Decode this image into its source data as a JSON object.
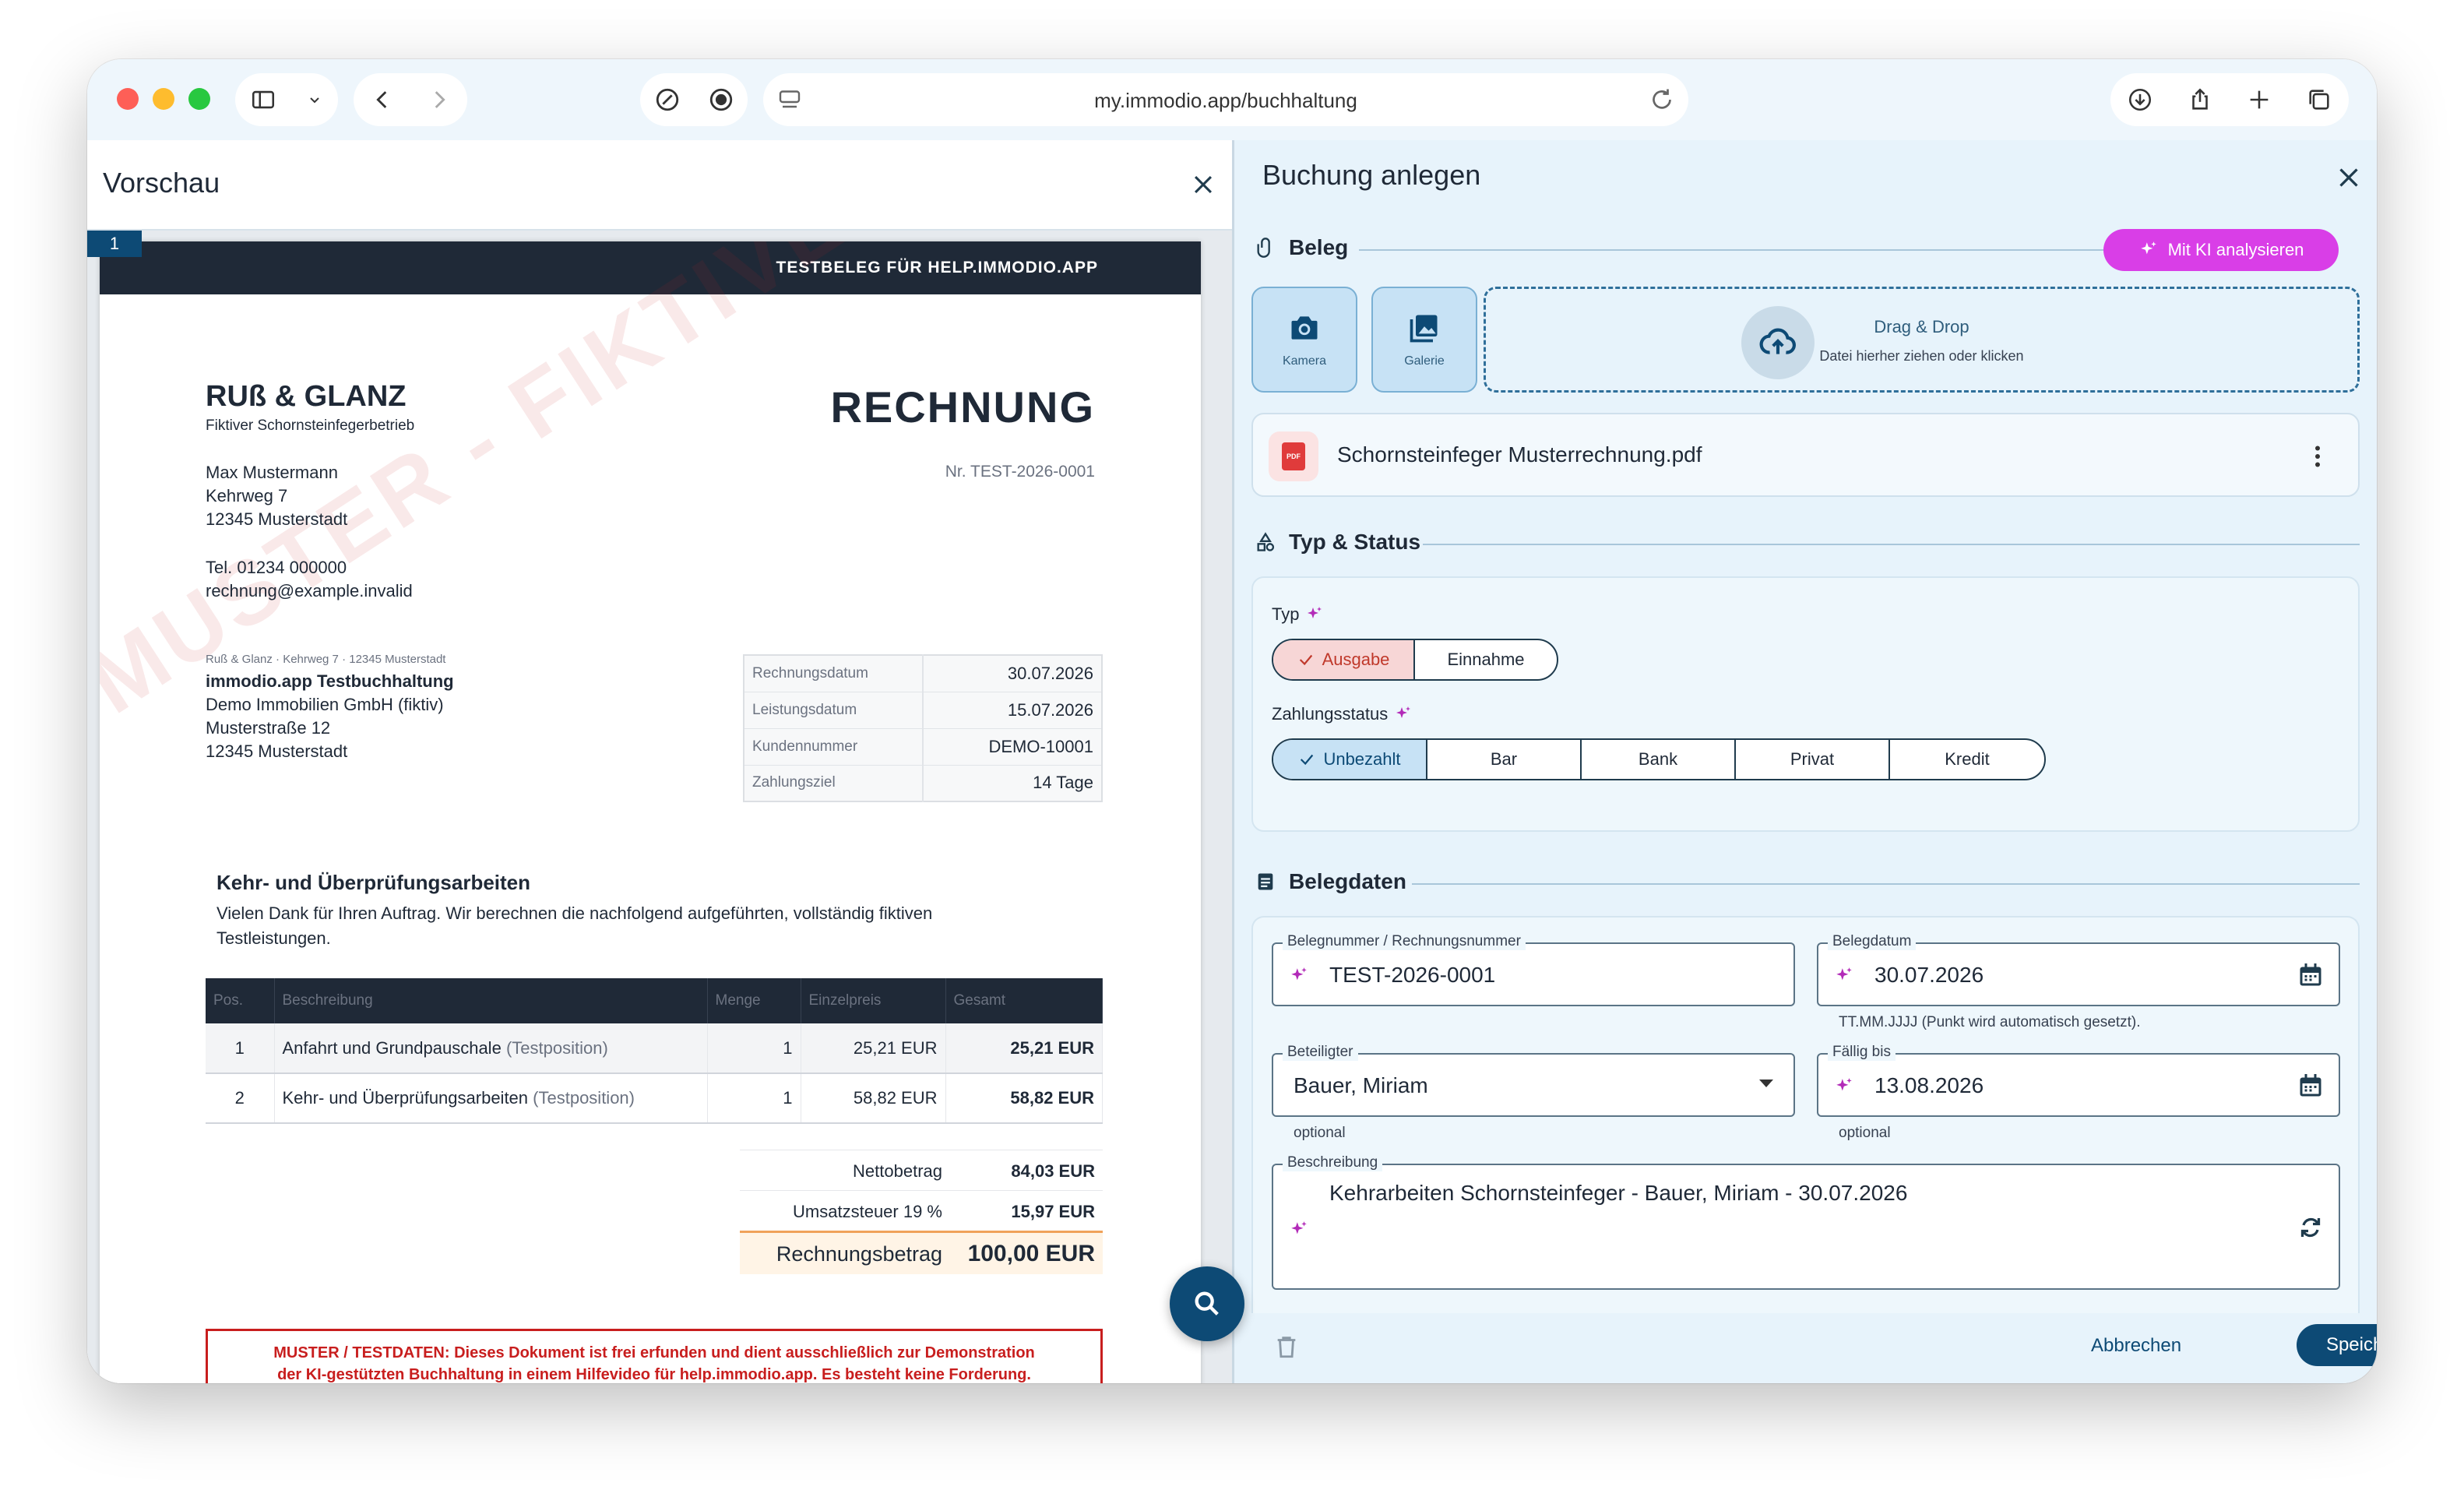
{
  "browser": {
    "url": "my.immodio.app/buchhaltung"
  },
  "preview": {
    "title": "Vorschau",
    "page_number": "1",
    "document": {
      "header_banner": "TESTBELEG FÜR HELP.IMMODIO.APP",
      "watermark": "MUSTER - FIKTIVE TESTDATEN - NUR TESTDATEN",
      "company_name": "RUß & GLANZ",
      "company_tagline": "Fiktiver Schornsteinfegerbetrieb",
      "sender_name": "Max Mustermann",
      "sender_street": "Kehrweg 7",
      "sender_city": "12345 Musterstadt",
      "sender_phone": "Tel. 01234 000000",
      "sender_email": "rechnung@example.invalid",
      "doc_title": "RECHNUNG",
      "doc_number": "Nr. TEST-2026-0001",
      "return_address": "Ruß & Glanz · Kehrweg 7 · 12345 Musterstadt",
      "recipient_line1": "immodio.app Testbuchhaltung",
      "recipient_line2": "Demo Immobilien GmbH (fiktiv)",
      "recipient_line3": "Musterstraße 12",
      "recipient_line4": "12345 Musterstadt",
      "meta": [
        {
          "key": "Rechnungsdatum",
          "value": "30.07.2026"
        },
        {
          "key": "Leistungsdatum",
          "value": "15.07.2026"
        },
        {
          "key": "Kundennummer",
          "value": "DEMO-10001"
        },
        {
          "key": "Zahlungsziel",
          "value": "14 Tage"
        }
      ],
      "section_title": "Kehr- und Überprüfungsarbeiten",
      "intro_line1": "Vielen Dank für Ihren Auftrag. Wir berechnen die nachfolgend aufgeführten, vollständig fiktiven",
      "intro_line2": "Testleistungen.",
      "table_headers": [
        "Pos.",
        "Beschreibung",
        "Menge",
        "Einzelpreis",
        "Gesamt"
      ],
      "rows": [
        {
          "pos": "1",
          "desc": "Anfahrt und Grundpauschale",
          "note": "(Testposition)",
          "qty": "1",
          "unit": "25,21 EUR",
          "total": "25,21 EUR"
        },
        {
          "pos": "2",
          "desc": "Kehr- und Überprüfungsarbeiten",
          "note": "(Testposition)",
          "qty": "1",
          "unit": "58,82 EUR",
          "total": "58,82 EUR"
        }
      ],
      "net_label": "Nettobetrag",
      "net_value": "84,03 EUR",
      "vat_label": "Umsatzsteuer 19 %",
      "vat_value": "15,97 EUR",
      "gross_label": "Rechnungsbetrag",
      "gross_value": "100,00 EUR",
      "warning_line1": "MUSTER / TESTDATEN: Dieses Dokument ist frei erfunden und dient ausschließlich zur Demonstration",
      "warning_line2": "der KI-gestützten Buchhaltung in einem Hilfevideo für help.immodio.app. Es besteht keine Forderung."
    }
  },
  "form": {
    "title": "Buchung anlegen",
    "beleg": {
      "heading": "Beleg",
      "ai_button": "Mit KI analysieren",
      "camera_label": "Kamera",
      "gallery_label": "Galerie",
      "drop_title": "Drag & Drop",
      "drop_subtitle": "Datei hierher ziehen oder klicken",
      "file_name": "Schornsteinfeger Musterrechnung.pdf"
    },
    "typ_status": {
      "heading": "Typ & Status",
      "typ_label": "Typ",
      "typ_options": [
        "Ausgabe",
        "Einnahme"
      ],
      "typ_selected": "Ausgabe",
      "status_label": "Zahlungsstatus",
      "status_options": [
        "Unbezahlt",
        "Bar",
        "Bank",
        "Privat",
        "Kredit"
      ],
      "status_selected": "Unbezahlt"
    },
    "belegdaten": {
      "heading": "Belegdaten",
      "belegnummer_label": "Belegnummer / Rechnungsnummer",
      "belegnummer_value": "TEST-2026-0001",
      "belegdatum_label": "Belegdatum",
      "belegdatum_value": "30.07.2026",
      "belegdatum_hint": "TT.MM.JJJJ (Punkt wird automatisch gesetzt).",
      "beteiligter_label": "Beteiligter",
      "beteiligter_value": "Bauer, Miriam",
      "beteiligter_hint": "optional",
      "faellig_label": "Fällig bis",
      "faellig_value": "13.08.2026",
      "faellig_hint": "optional",
      "beschreibung_label": "Beschreibung",
      "beschreibung_value": "Kehrarbeiten Schornsteinfeger - Bauer, Miriam - 30.07.2026"
    },
    "cancel_label": "Abbrechen",
    "save_label": "Speichern"
  }
}
